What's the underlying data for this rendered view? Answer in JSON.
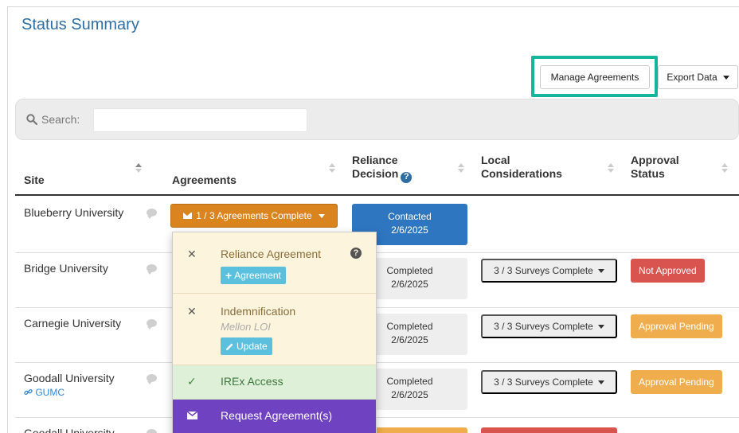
{
  "page_title": "Status Summary",
  "toolbar": {
    "manage_label": "Manage Agreements",
    "export_label": "Export Data"
  },
  "search": {
    "label": "Search:",
    "value": ""
  },
  "columns": {
    "site": "Site",
    "agreements": "Agreements",
    "reliance_line1": "Reliance",
    "reliance_line2": "Decision",
    "local_line1": "Local",
    "local_line2": "Considerations",
    "approval_line1": "Approval",
    "approval_line2": "Status"
  },
  "rows": [
    {
      "site": "Blueberry University",
      "agreements": "1 / 3 Agreements Complete",
      "decision_status": "Contacted",
      "decision_date": "2/6/2025"
    },
    {
      "site": "Bridge University",
      "decision_status": "Completed",
      "decision_date": "2/6/2025",
      "local": "3 / 3 Surveys Complete",
      "approval": "Not Approved"
    },
    {
      "site": "Carnegie University",
      "decision_status": "Completed",
      "decision_date": "2/6/2025",
      "local": "3 / 3 Surveys Complete",
      "approval": "Approval Pending"
    },
    {
      "site": "Goodall University",
      "sublink": "GUMC",
      "decision_status": "Completed",
      "decision_date": "2/6/2025",
      "local": "3 / 3 Surveys Complete",
      "approval": "Approval Pending"
    },
    {
      "site": "Goodall University"
    }
  ],
  "dropdown": {
    "items": [
      {
        "status": "incomplete",
        "mark": "✕",
        "title": "Reliance Agreement",
        "action": "Agreement",
        "action_icon": "plus-icon"
      },
      {
        "status": "incomplete",
        "mark": "✕",
        "title": "Indemnification",
        "subtitle": "Mellon LOI",
        "action": "Update",
        "action_icon": "pencil-icon"
      },
      {
        "status": "complete",
        "mark": "✓",
        "title": "IREx Access"
      },
      {
        "status": "action",
        "title": "Request Agreement(s)",
        "icon": "envelope-icon"
      }
    ]
  },
  "colors": {
    "title_blue": "#2f6ea3",
    "highlight": "#14b59a",
    "agreement_orange": "#d9841e",
    "contacted_blue": "#2e76c0",
    "not_approved_red": "#d9534f",
    "pending_orange": "#f0ad4e",
    "dropdown_yellow": "#fcf4dc",
    "dropdown_green": "#dff0d8",
    "dropdown_purple": "#6f42c1",
    "action_cyan": "#5bc0de"
  }
}
